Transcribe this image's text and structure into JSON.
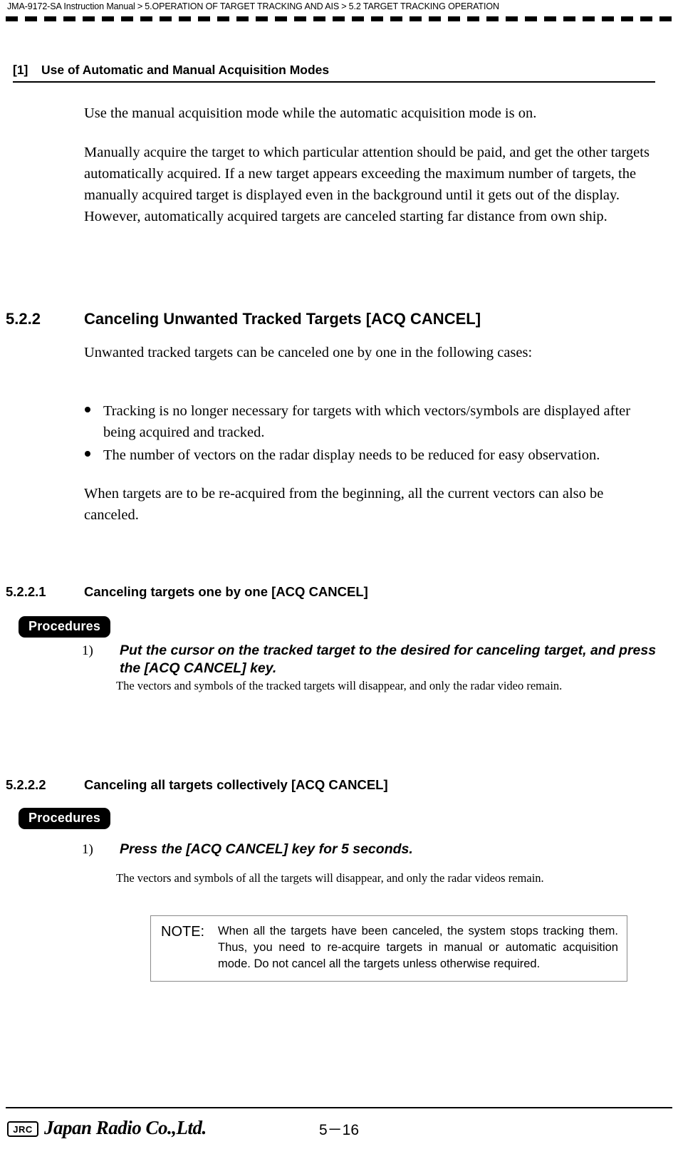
{
  "header": {
    "manual": "JMA-9172-SA Instruction Manual",
    "sep": ">",
    "crumb2": "5.OPERATION OF TARGET TRACKING AND AIS",
    "crumb3": "5.2  TARGET TRACKING OPERATION"
  },
  "section1": {
    "number": "[1]",
    "title": "Use of Automatic and Manual Acquisition Modes",
    "para1": "Use the manual acquisition mode while the automatic acquisition mode is on.",
    "para2": "Manually acquire the target to which particular attention should be paid, and get the other targets automatically acquired. If a new target appears exceeding the maximum number of targets, the manually acquired target is displayed even in the background until it gets out of the display. However, automatically acquired targets are canceled starting far distance from own ship."
  },
  "section522": {
    "number": "5.2.2",
    "title": "Canceling Unwanted Tracked Targets [ACQ CANCEL]",
    "intro": "Unwanted tracked targets can be canceled one by one in the following cases:",
    "bullets": [
      "Tracking is no longer necessary for targets with which vectors/symbols are displayed after being acquired and tracked.",
      "The number of vectors on the radar display needs to be reduced for easy observation."
    ],
    "outro": "When targets are to be re-acquired from the beginning, all the current vectors can also be canceled."
  },
  "section5221": {
    "number": "5.2.2.1",
    "title": "Canceling targets one by one [ACQ CANCEL]",
    "procedures_label": "Procedures",
    "step_number": "1)",
    "step_text": "Put the cursor on the tracked target to the desired for canceling target, and press the [ACQ CANCEL] key.",
    "step_note": "The vectors and symbols of the tracked targets will disappear, and only the radar video remain."
  },
  "section5222": {
    "number": "5.2.2.2",
    "title": "Canceling all targets collectively [ACQ CANCEL]",
    "procedures_label": "Procedures",
    "step_number": "1)",
    "step_text": "Press the [ACQ CANCEL] key for 5 seconds.",
    "step_note": "The vectors and symbols of all the targets will disappear, and only the radar videos remain."
  },
  "note_box": {
    "label": "NOTE:",
    "text": "When all the targets have been canceled, the system stops tracking them. Thus, you need to re-acquire targets in manual or automatic acquisition mode. Do not cancel all the targets unless otherwise required."
  },
  "footer": {
    "logo_mark": "JRC",
    "wordmark": "Japan Radio Co.,Ltd.",
    "page": "5－16"
  }
}
